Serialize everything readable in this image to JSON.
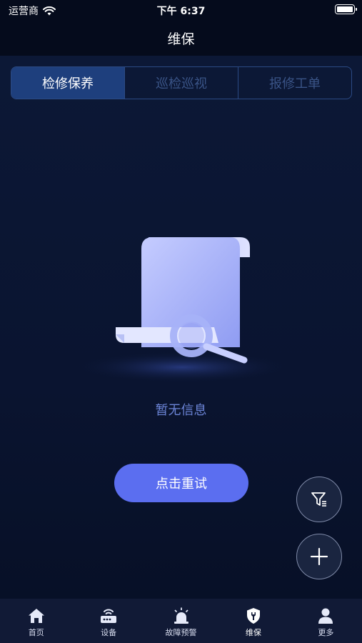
{
  "status_bar": {
    "carrier": "运营商",
    "time": "下午 6:37"
  },
  "nav": {
    "title": "维保"
  },
  "segments": [
    {
      "label": "检修保养",
      "active": true
    },
    {
      "label": "巡检巡视",
      "active": false
    },
    {
      "label": "报修工单",
      "active": false
    }
  ],
  "empty_state": {
    "message": "暂无信息",
    "retry_label": "点击重试"
  },
  "fabs": {
    "filter_icon": "filter-icon",
    "add_icon": "plus-icon"
  },
  "tabbar": [
    {
      "label": "首页",
      "icon": "home-icon"
    },
    {
      "label": "设备",
      "icon": "device-icon"
    },
    {
      "label": "故障预警",
      "icon": "alarm-icon"
    },
    {
      "label": "维保",
      "icon": "maintenance-icon",
      "active": true
    },
    {
      "label": "更多",
      "icon": "user-icon"
    }
  ],
  "colors": {
    "accent": "#5b6ef0",
    "active_segment": "#1e3f7d",
    "background": "#0b1530"
  }
}
